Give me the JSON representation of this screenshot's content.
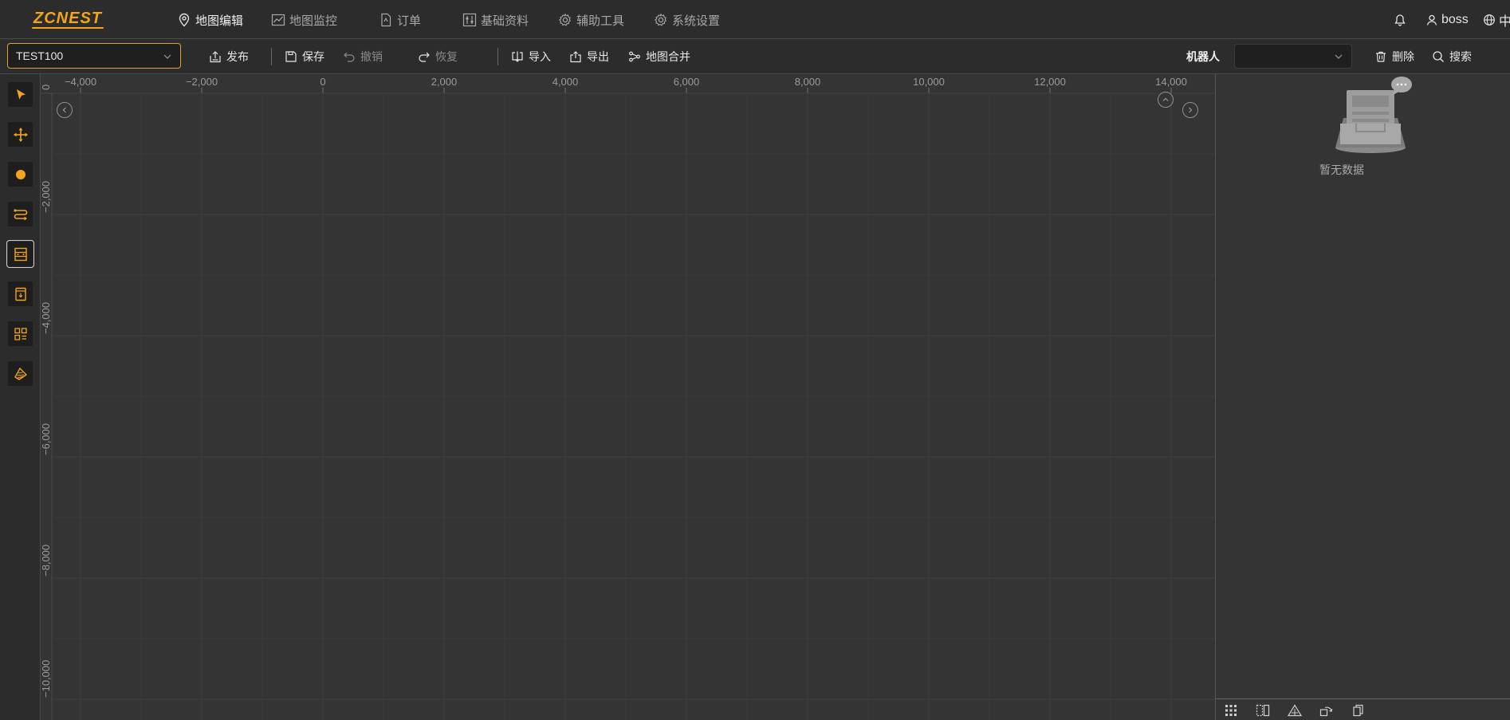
{
  "app": {
    "logo_text": "ZCNEST",
    "accent_color": "#f0a51c"
  },
  "nav": [
    {
      "id": "map-edit",
      "label": "地图编辑",
      "icon": "map-pin-icon",
      "active": true
    },
    {
      "id": "map-monitor",
      "label": "地图监控",
      "icon": "line-chart-icon",
      "active": false
    },
    {
      "id": "orders",
      "label": "订单",
      "icon": "document-icon",
      "active": false
    },
    {
      "id": "base-data",
      "label": "基础资料",
      "icon": "sliders-icon",
      "active": false
    },
    {
      "id": "aux-tools",
      "label": "辅助工具",
      "icon": "gear-icon",
      "active": false
    },
    {
      "id": "system-settings",
      "label": "系统设置",
      "icon": "gear-icon",
      "active": false
    }
  ],
  "header_right": {
    "user": "boss",
    "language": "中"
  },
  "toolbar": {
    "map_select_value": "TEST100",
    "publish": "发布",
    "save": "保存",
    "undo": "撤销",
    "redo": "恢复",
    "import": "导入",
    "export": "导出",
    "merge": "地图合并",
    "robot_label": "机器人",
    "robot_value": "",
    "delete": "删除",
    "search": "搜索"
  },
  "left_tools": [
    {
      "name": "select-tool",
      "icon": "cursor-arrow-icon",
      "selected": false
    },
    {
      "name": "move-tool",
      "icon": "move-arrows-icon",
      "selected": false
    },
    {
      "name": "point-tool",
      "icon": "dot-icon",
      "selected": false
    },
    {
      "name": "path-tool",
      "icon": "path-arrows-icon",
      "selected": false
    },
    {
      "name": "shelf-tool",
      "icon": "shelf-icon",
      "selected": true
    },
    {
      "name": "station-tool",
      "icon": "station-icon",
      "selected": false
    },
    {
      "name": "area-group-tool",
      "icon": "grid-squares-icon",
      "selected": false
    },
    {
      "name": "region-tool",
      "icon": "region-icon",
      "selected": false
    }
  ],
  "canvas": {
    "x_ticks": [
      "−4,000",
      "−2,000",
      "0",
      "2,000",
      "4,000",
      "6,000",
      "8,000",
      "10,000",
      "12,000",
      "14,000"
    ],
    "y_ticks": [
      "0",
      "−2,000",
      "−4,000",
      "−6,000",
      "−8,000",
      "−10,000"
    ]
  },
  "right_panel": {
    "empty_text": "暂无数据"
  },
  "bottom_tools": [
    "grid-dots-icon",
    "split-view-icon",
    "triangle-warning-icon",
    "rotate-icon",
    "copy-icon"
  ]
}
